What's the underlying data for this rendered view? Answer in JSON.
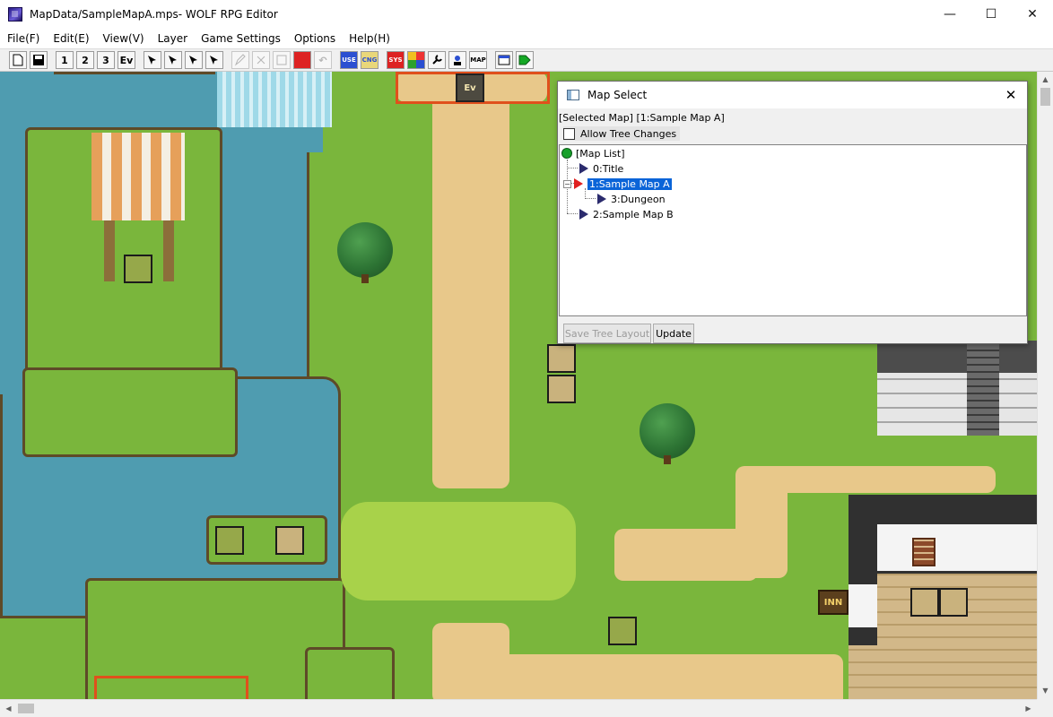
{
  "window": {
    "title": "MapData/SampleMapA.mps- WOLF RPG Editor",
    "minimize": "—",
    "maximize": "☐",
    "close": "✕"
  },
  "menu": [
    {
      "label": "File(F)"
    },
    {
      "label": "Edit(E)"
    },
    {
      "label": "View(V)"
    },
    {
      "label": "Layer"
    },
    {
      "label": "Game Settings"
    },
    {
      "label": "Options"
    },
    {
      "label": "Help(H)"
    }
  ],
  "toolbar": {
    "layer1": "1",
    "layer2": "2",
    "layer3": "3",
    "event_layer": "Ev",
    "undo": "↶",
    "user_db": "USE",
    "changeable_db": "CNG",
    "system_db": "SYS",
    "map_select": "MAP"
  },
  "map": {
    "event_top_label": "Ev",
    "inn_sign": "INN"
  },
  "map_select": {
    "title": "Map Select",
    "close": "✕",
    "selected_map": "[Selected Map]  [1:Sample Map A]",
    "allow_tree_changes": "Allow Tree Changes",
    "tree": {
      "root": "[Map List]",
      "items": [
        {
          "label": "0:Title"
        },
        {
          "label": "1:Sample Map A"
        },
        {
          "label": "3:Dungeon"
        },
        {
          "label": "2:Sample Map B"
        }
      ]
    },
    "save_tree_layout": "Save Tree Layout",
    "update": "Update"
  }
}
